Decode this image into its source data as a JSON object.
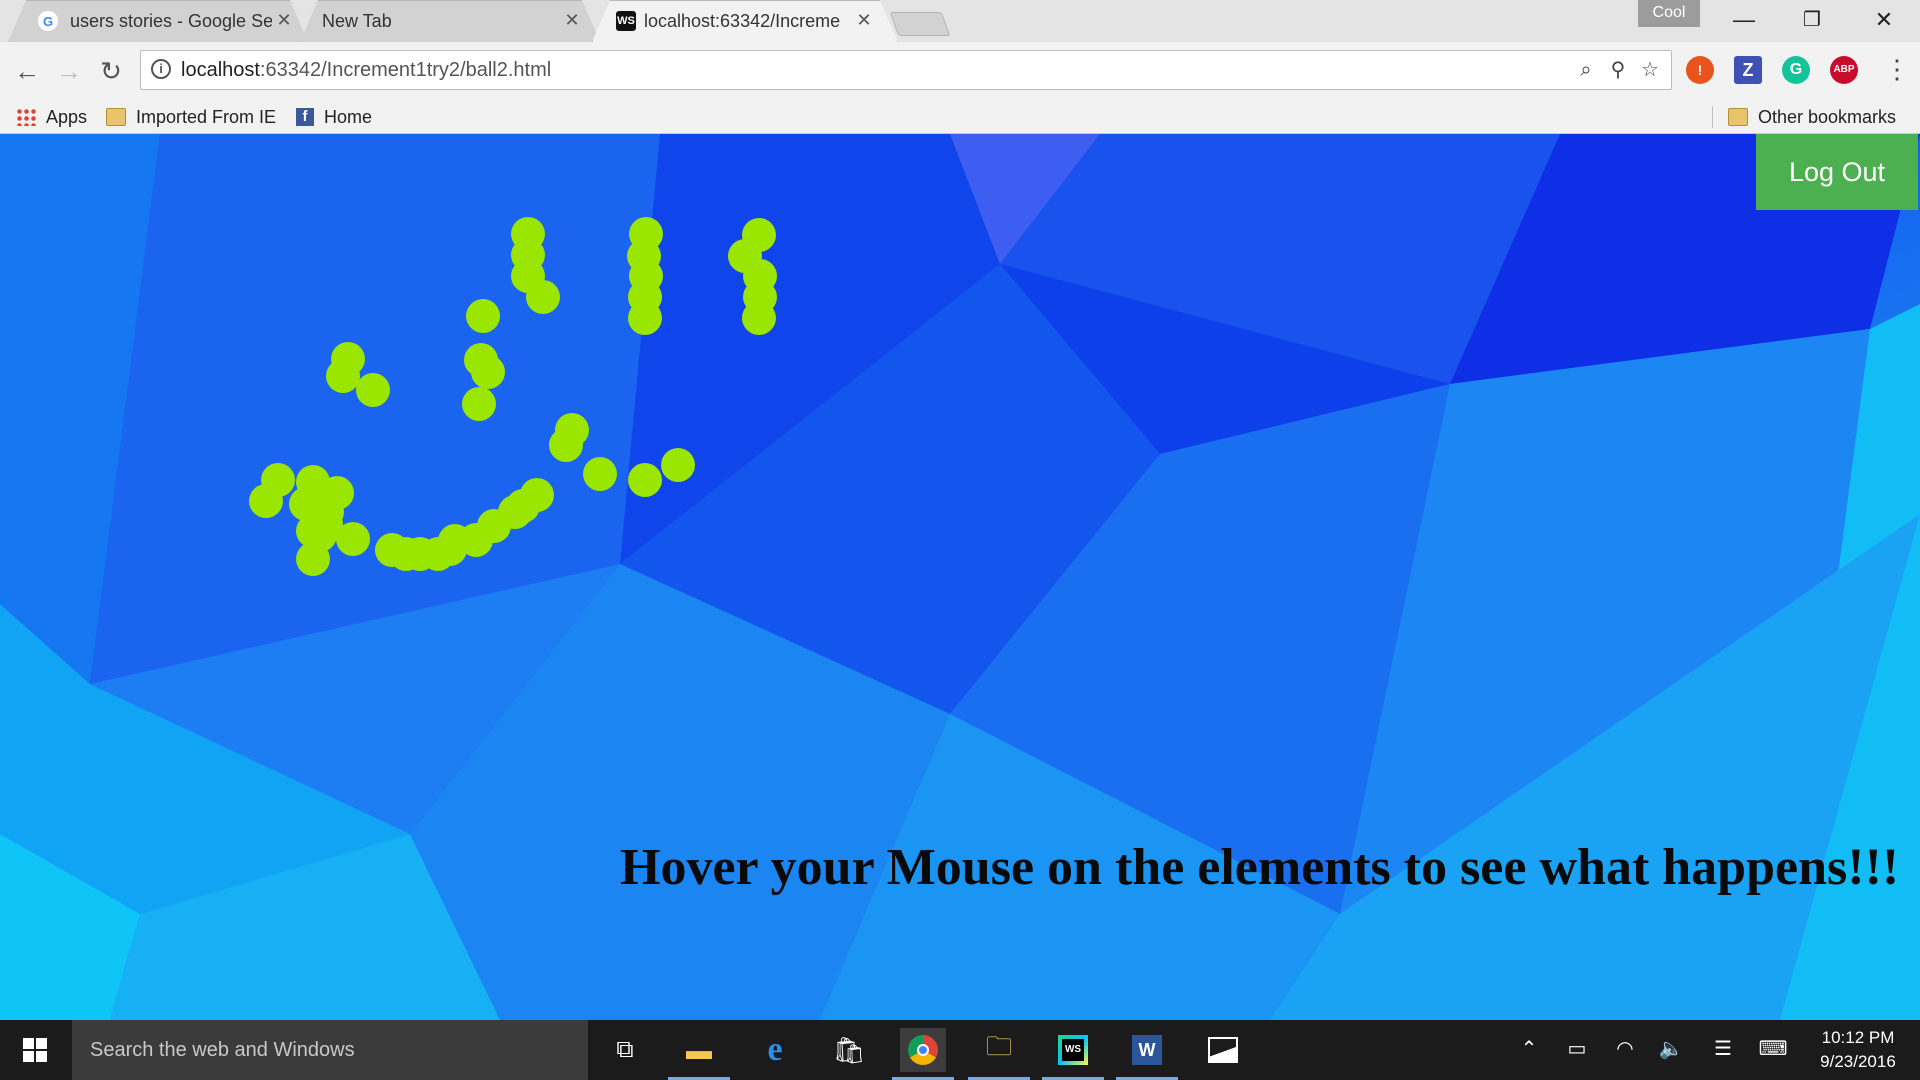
{
  "tabs": [
    {
      "title": "users stories - Google Se",
      "icon": "google-icon"
    },
    {
      "title": "New Tab",
      "icon": ""
    },
    {
      "title": "localhost:63342/Increme",
      "icon": "webstorm-icon"
    }
  ],
  "profile_name": "Cool",
  "toolbar": {
    "url_host": "localhost",
    "url_path": ":63342/Increment1try2/ball2.html"
  },
  "bookmarks": {
    "apps": "Apps",
    "imported": "Imported From IE",
    "home": "Home",
    "other": "Other bookmarks"
  },
  "page": {
    "logout_label": "Log Out",
    "hover_text": "Hover your Mouse on the elements to see what happens!!!",
    "ball_color": "#9ae600",
    "button_color": "#4caf50"
  },
  "taskbar": {
    "search_placeholder": "Search the web and Windows",
    "time": "10:12 PM",
    "date": "9/23/2016"
  }
}
